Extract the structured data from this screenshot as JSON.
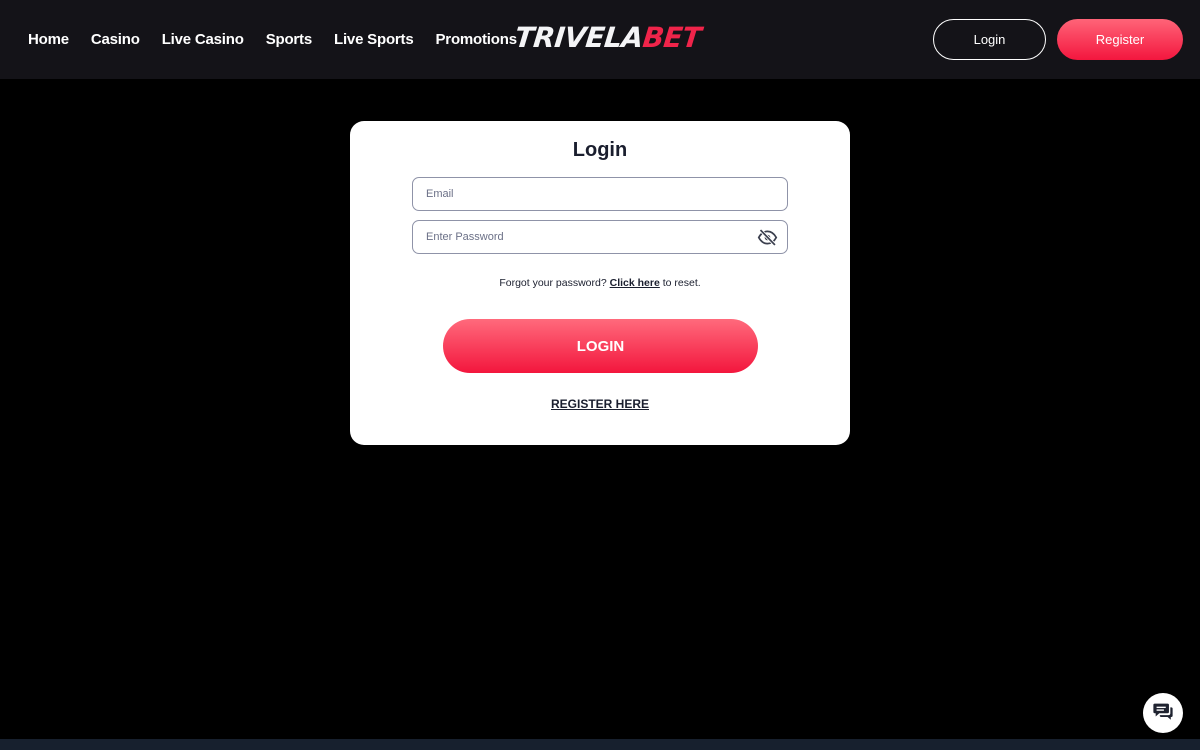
{
  "header": {
    "nav": [
      {
        "label": "Home"
      },
      {
        "label": "Casino"
      },
      {
        "label": "Live Casino"
      },
      {
        "label": "Sports"
      },
      {
        "label": "Live Sports"
      },
      {
        "label": "Promotions"
      }
    ],
    "logo": {
      "part1": "TRIVELA",
      "part2": "BET"
    },
    "login_label": "Login",
    "register_label": "Register"
  },
  "login_form": {
    "title": "Login",
    "email_placeholder": "Email",
    "password_placeholder": "Enter Password",
    "forgot_prefix": "Forgot your password? ",
    "forgot_link": "Click here",
    "forgot_suffix": " to reset.",
    "submit_label": "LOGIN",
    "register_label": "REGISTER HERE"
  },
  "colors": {
    "accent": "#f3163e",
    "header_bg": "#141318",
    "page_bg": "#000000",
    "card_bg": "#ffffff"
  },
  "icons": {
    "password_toggle": "eye-slash-icon",
    "chat": "chat-icon"
  }
}
